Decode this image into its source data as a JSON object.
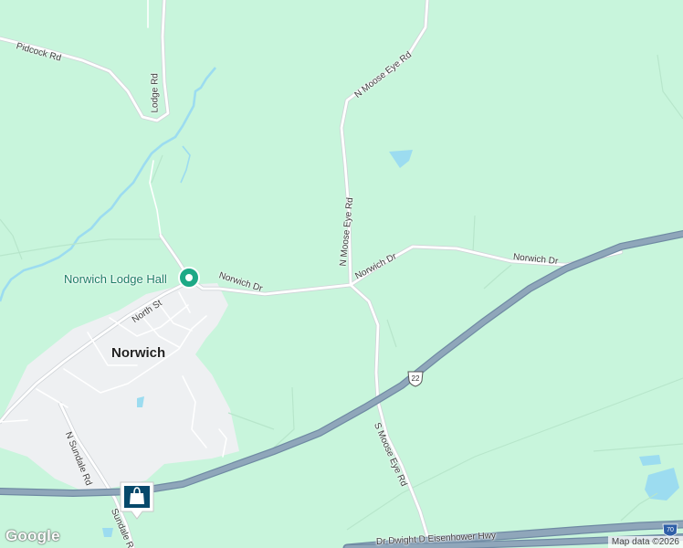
{
  "map": {
    "colors": {
      "background": "#c8f5dc",
      "town_area": "#eef0f2",
      "water": "#9cdcf0",
      "road": "#ffffff",
      "road_casing": "#d0d4d8",
      "highway": "#8fa6ba",
      "highway_edge": "#6f8aa3",
      "poi": "#1da986",
      "marker": "#07496b"
    },
    "roads": {
      "pidcock": "Pidcock Rd",
      "lodge": "Lodge Rd",
      "n_moose_eye_top": "N Moose Eye Rd",
      "n_moose_eye": "N Moose Eye Rd",
      "norwich_dr_left": "Norwich Dr",
      "norwich_dr_mid": "Norwich Dr",
      "norwich_dr_right": "Norwich Dr",
      "north_st": "North St",
      "n_sundale": "N Sundale Rd",
      "sundale": "Sundale Rd",
      "s_moose_eye": "S Moose Eye Rd",
      "eisenhower": "Dr Dwight D Eisenhower Hwy"
    },
    "places": {
      "town": "Norwich",
      "poi": "Norwich Lodge Hall"
    },
    "shields": {
      "us22": "22",
      "i70": "70"
    },
    "icons": {
      "poi": "pin-icon",
      "shopping": "shopping-bag-icon"
    },
    "attribution": "Map data ©2026",
    "logo": "Google"
  }
}
